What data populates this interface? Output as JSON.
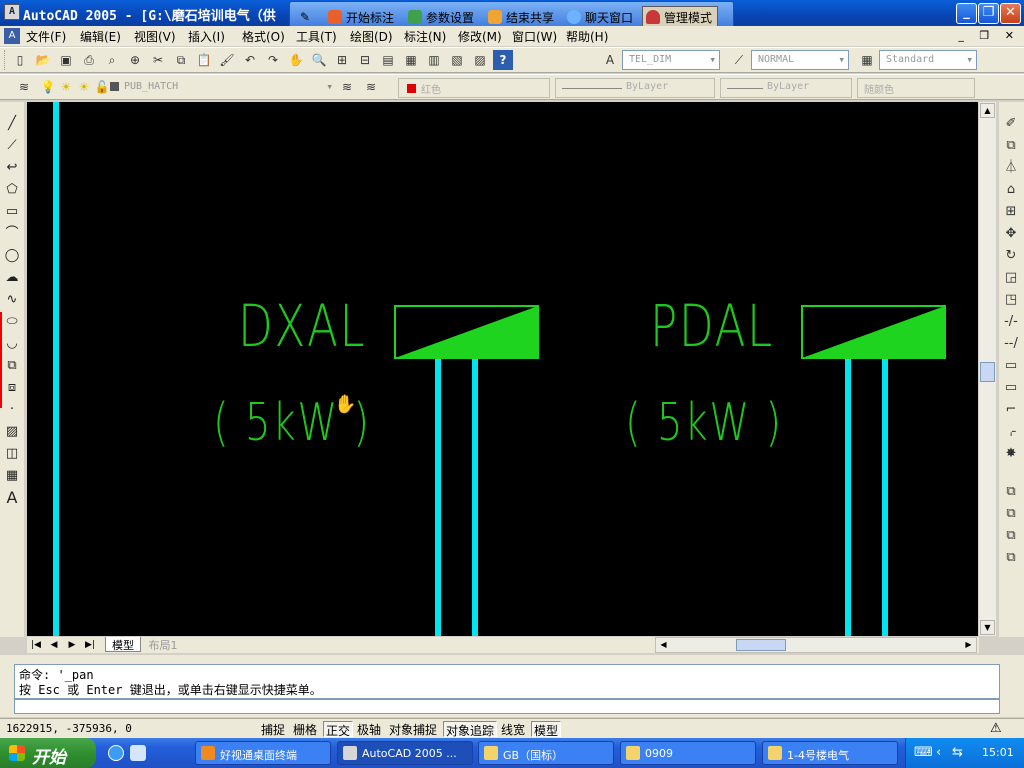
{
  "window": {
    "title": "AutoCAD 2005 - [G:\\磨石培训电气（供",
    "min": "_",
    "max": "❐",
    "close": "✕"
  },
  "floatbar": {
    "items": [
      {
        "label": "开始标注",
        "color": "#e9602a"
      },
      {
        "label": "参数设置",
        "color": "#3ea04b"
      },
      {
        "label": "结束共享",
        "color": "#f0a431"
      },
      {
        "label": "聊天窗口",
        "color": "#6cb2ff"
      },
      {
        "label": "管理模式",
        "color": "#c93838"
      }
    ]
  },
  "menubar": {
    "items": [
      "文件(F)",
      "编辑(E)",
      "视图(V)",
      "插入(I)",
      "格式(O)",
      "工具(T)",
      "绘图(D)",
      "标注(N)",
      "修改(M)",
      "窗口(W)",
      "帮助(H)"
    ],
    "mdi": "_ ❐ ✕"
  },
  "toolbar1": {
    "dimstyle": "TEL_DIM",
    "textstyle": "NORMAL",
    "tablestyle": "Standard"
  },
  "toolbar2": {
    "layer": "PUB_HATCH",
    "color": "红色",
    "linetype": "ByLayer",
    "lineweight": "ByLayer",
    "plotstyle": "随颜色"
  },
  "drawing": {
    "label1": "DXAL",
    "label1_sub": "( 5kW )",
    "label2": "PDAL",
    "label2_sub": "( 5kW )"
  },
  "tabs": {
    "model": "模型",
    "layout": "布局1"
  },
  "command": {
    "line1": "命令: '_pan",
    "line2": "按 Esc 或 Enter 键退出，或单击右键显示快捷菜单。"
  },
  "status": {
    "coords": "1622915, -375936, 0",
    "buttons": [
      {
        "label": "捕捉",
        "on": false
      },
      {
        "label": "栅格",
        "on": false
      },
      {
        "label": "正交",
        "on": true
      },
      {
        "label": "极轴",
        "on": false
      },
      {
        "label": "对象捕捉",
        "on": false
      },
      {
        "label": "对象追踪",
        "on": true
      },
      {
        "label": "线宽",
        "on": false
      },
      {
        "label": "模型",
        "on": true
      }
    ]
  },
  "taskbar": {
    "start": "开始",
    "tasks": [
      {
        "label": "好视通桌面终端",
        "color": "#f08a1e",
        "active": false
      },
      {
        "label": "AutoCAD 2005 ...",
        "color": "#d6d6d6",
        "active": true
      },
      {
        "label": "GB（国标）",
        "color": "#f4d36b",
        "active": false
      },
      {
        "label": "0909",
        "color": "#f4d36b",
        "active": false
      },
      {
        "label": "1-4号楼电气",
        "color": "#f4d36b",
        "active": false
      }
    ],
    "time": "15:01"
  }
}
